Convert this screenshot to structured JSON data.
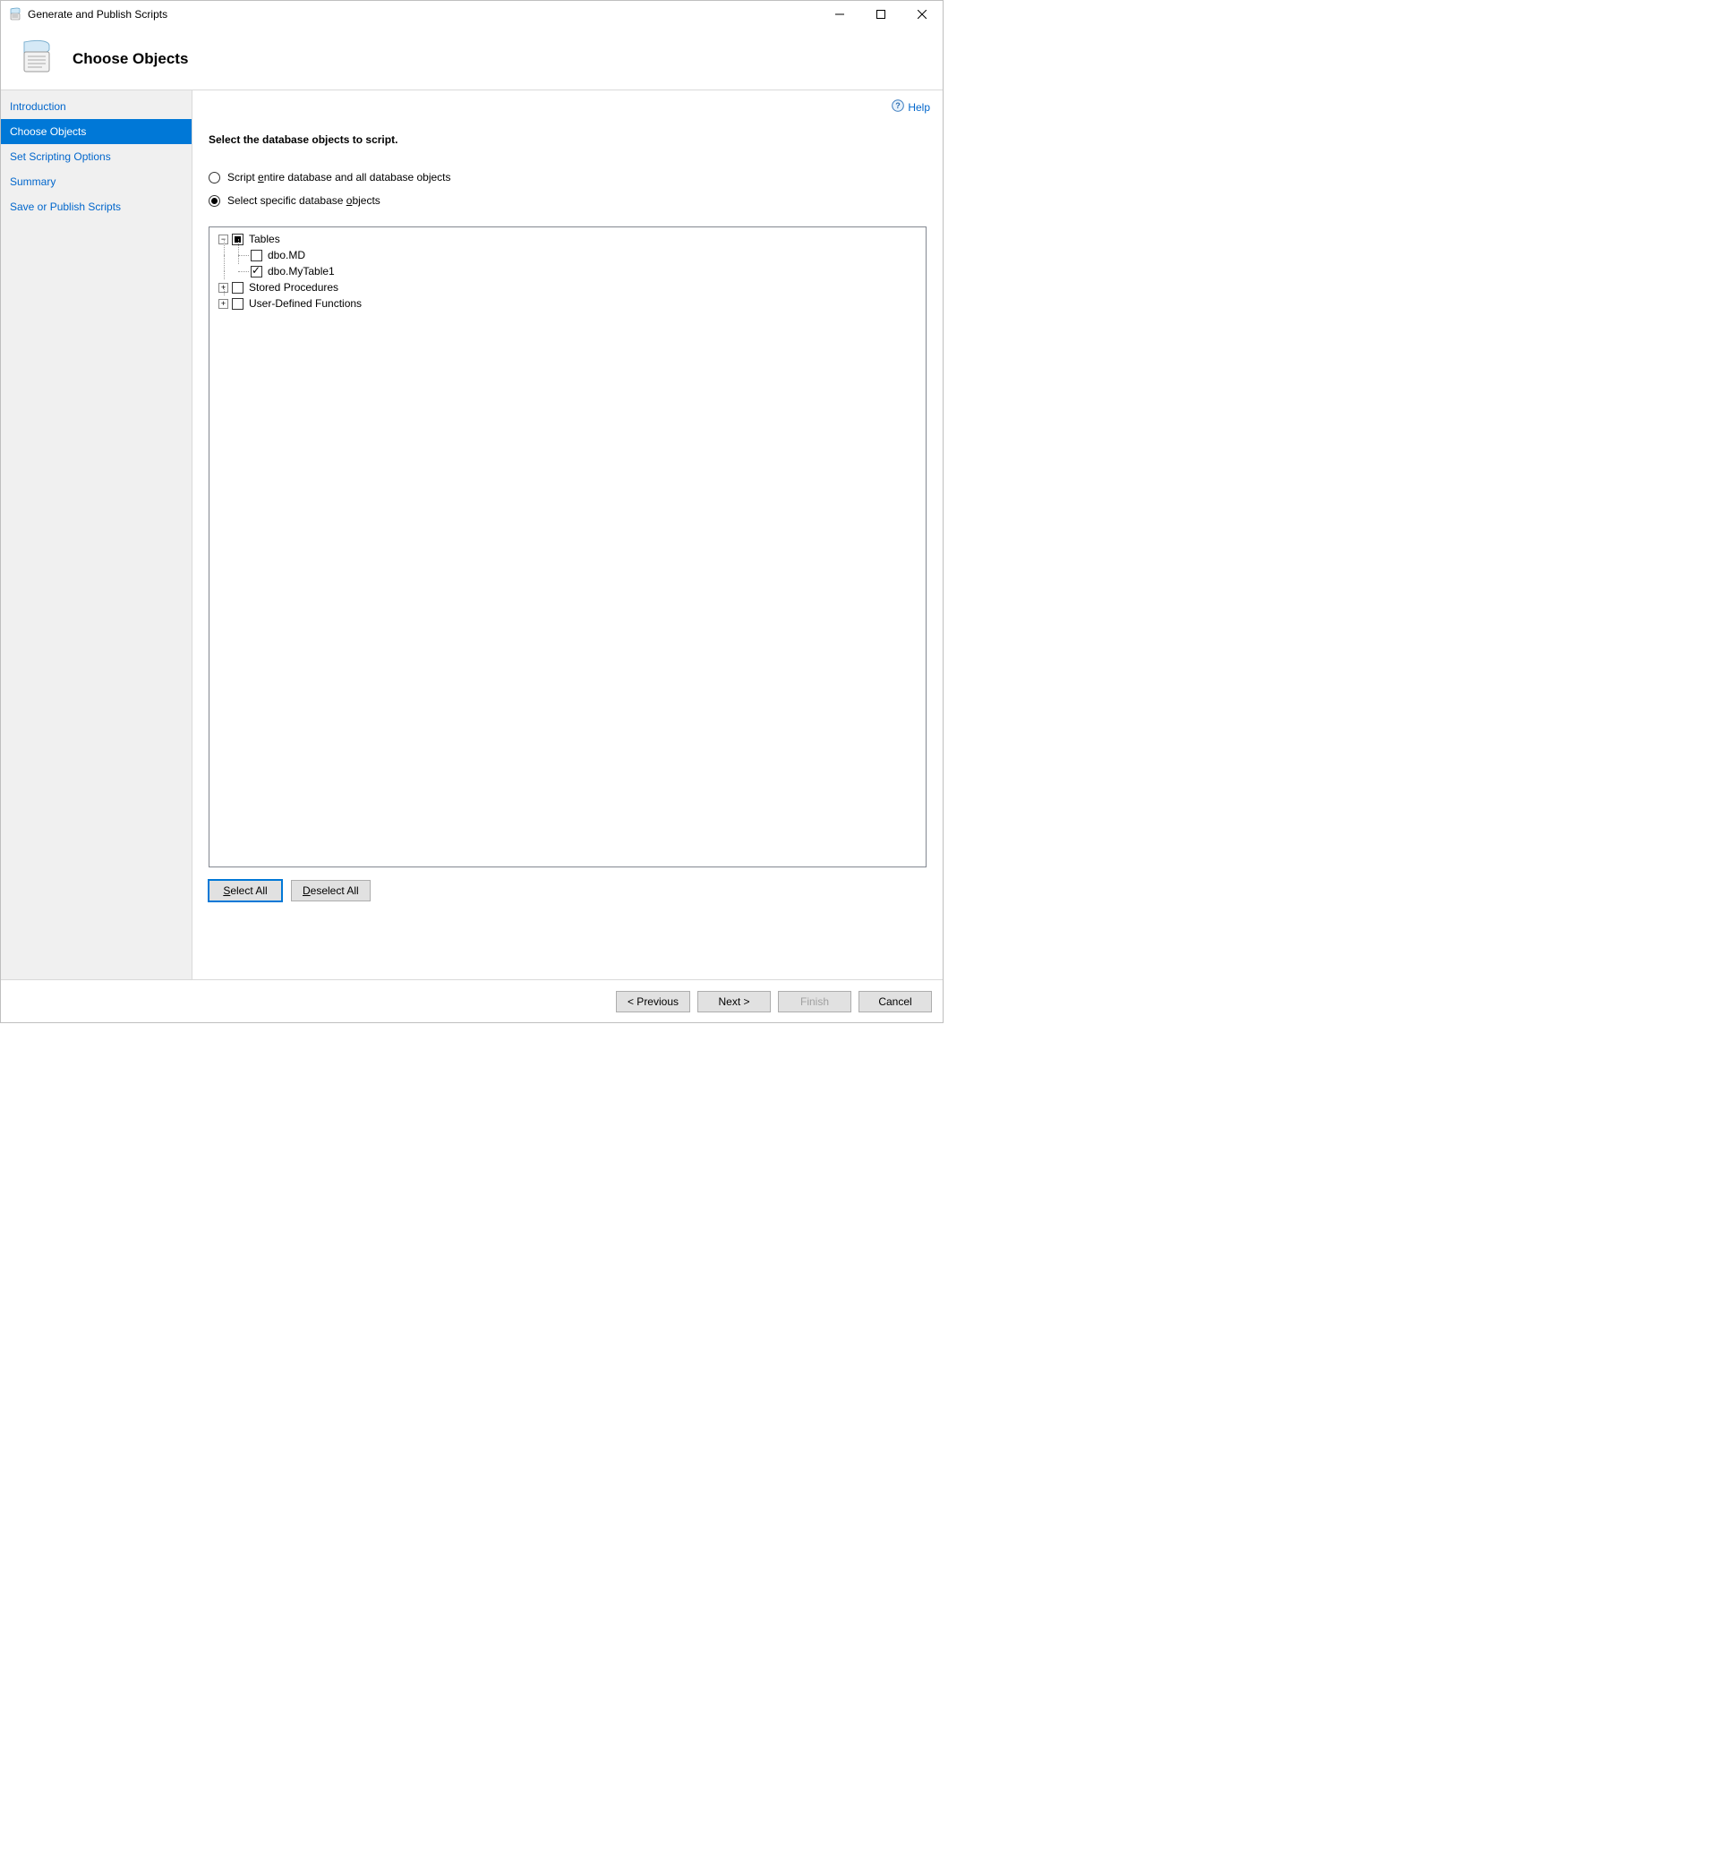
{
  "window": {
    "title": "Generate and Publish Scripts"
  },
  "header": {
    "page_title": "Choose Objects"
  },
  "help": {
    "label": "Help"
  },
  "sidebar": {
    "items": [
      {
        "label": "Introduction"
      },
      {
        "label": "Choose Objects"
      },
      {
        "label": "Set Scripting Options"
      },
      {
        "label": "Summary"
      },
      {
        "label": "Save or Publish Scripts"
      }
    ]
  },
  "main": {
    "section_title": "Select the database objects to script.",
    "radio_all_pre": "Script ",
    "radio_all_u": "e",
    "radio_all_post": "ntire database and all database objects",
    "radio_specific_pre": "Select specific database ",
    "radio_specific_u": "o",
    "radio_specific_post": "bjects",
    "tree": {
      "tables_label": "Tables",
      "table_items": [
        {
          "label": "dbo.MD",
          "checked": false
        },
        {
          "label": "dbo.MyTable1",
          "checked": true
        }
      ],
      "sp_label": "Stored Procedures",
      "udf_label": "User-Defined Functions"
    },
    "select_all_u": "S",
    "select_all_post": "elect All",
    "deselect_all_u": "D",
    "deselect_all_post": "eselect All"
  },
  "footer": {
    "previous": "< Previous",
    "next": "Next >",
    "finish": "Finish",
    "cancel": "Cancel"
  }
}
